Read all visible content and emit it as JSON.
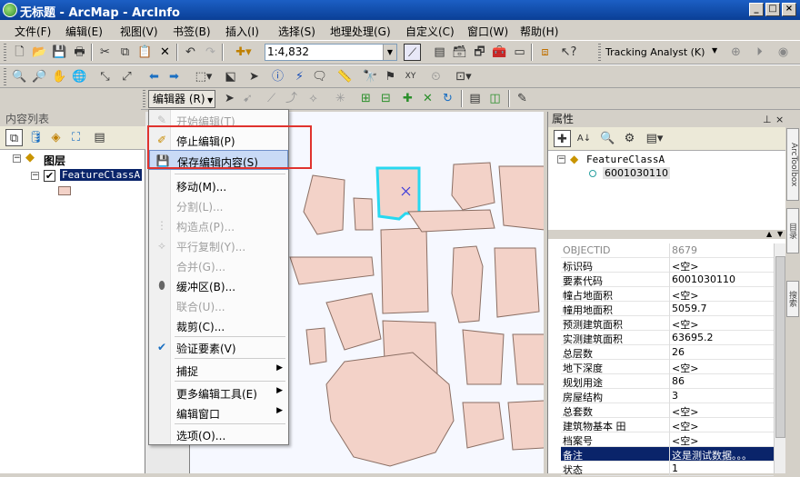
{
  "window": {
    "title": "无标题 - ArcMap - ArcInfo",
    "minimize": "_",
    "maximize": "□",
    "close": "×"
  },
  "menubar": {
    "items": [
      "文件(F)",
      "编辑(E)",
      "视图(V)",
      "书签(B)",
      "插入(I)",
      "选择(S)",
      "地理处理(G)",
      "自定义(C)",
      "窗口(W)",
      "帮助(H)"
    ]
  },
  "toolbar1": {
    "scale": "1:4,832",
    "tracking_analyst": "Tracking Analyst (K)"
  },
  "editor_toolbar": {
    "label": "编辑器 (R)"
  },
  "toc": {
    "title": "内容列表",
    "layers_label": "图层",
    "layer_name": "FeatureClassA"
  },
  "editor_menu": {
    "items": [
      {
        "label": "开始编辑(T)",
        "disabled": true
      },
      {
        "label": "停止编辑(P)",
        "disabled": false
      },
      {
        "label": "保存编辑内容(S)",
        "disabled": false
      },
      {
        "label": "移动(M)...",
        "disabled": false
      },
      {
        "label": "分割(L)...",
        "disabled": true
      },
      {
        "label": "构造点(P)...",
        "disabled": true
      },
      {
        "label": "平行复制(Y)...",
        "disabled": true
      },
      {
        "label": "合并(G)...",
        "disabled": true
      },
      {
        "label": "缓冲区(B)...",
        "disabled": false
      },
      {
        "label": "联合(U)...",
        "disabled": true
      },
      {
        "label": "裁剪(C)...",
        "disabled": false
      },
      {
        "label": "验证要素(V)",
        "disabled": false
      },
      {
        "label": "捕捉",
        "disabled": false
      },
      {
        "label": "更多编辑工具(E)",
        "disabled": false
      },
      {
        "label": "编辑窗口",
        "disabled": false
      },
      {
        "label": "选项(O)...",
        "disabled": false
      }
    ]
  },
  "properties": {
    "title": "属性",
    "tree_class": "FeatureClassA",
    "tree_feature": "6001030110",
    "rows": [
      {
        "name": "OBJECTID",
        "value": "8679"
      },
      {
        "name": "标识码",
        "value": "<空>"
      },
      {
        "name": "要素代码",
        "value": "6001030110"
      },
      {
        "name": "幢占地面积",
        "value": "<空>"
      },
      {
        "name": "幢用地面积",
        "value": "5059.7"
      },
      {
        "name": "预测建筑面积",
        "value": "<空>"
      },
      {
        "name": "实测建筑面积",
        "value": "63695.2"
      },
      {
        "name": "总层数",
        "value": "26"
      },
      {
        "name": "地下深度",
        "value": "<空>"
      },
      {
        "name": "规划用途",
        "value": "86"
      },
      {
        "name": "房屋结构",
        "value": "3"
      },
      {
        "name": "总套数",
        "value": "<空>"
      },
      {
        "name": "建筑物基本 田",
        "value": "<空>"
      },
      {
        "name": "档案号",
        "value": "<空>"
      },
      {
        "name": "备注",
        "value": "这是测试数据。。。"
      },
      {
        "name": "状态",
        "value": "1"
      }
    ]
  },
  "dock_tabs": [
    "ArcToolbox",
    "目录",
    "搜索"
  ],
  "colors": {
    "title_bar": "#0a3f96",
    "selection_outline": "#28d8f0",
    "building_fill": "#f3d2c8",
    "highlight_box": "#e0332e",
    "menu_hover": "#c9daf6"
  }
}
